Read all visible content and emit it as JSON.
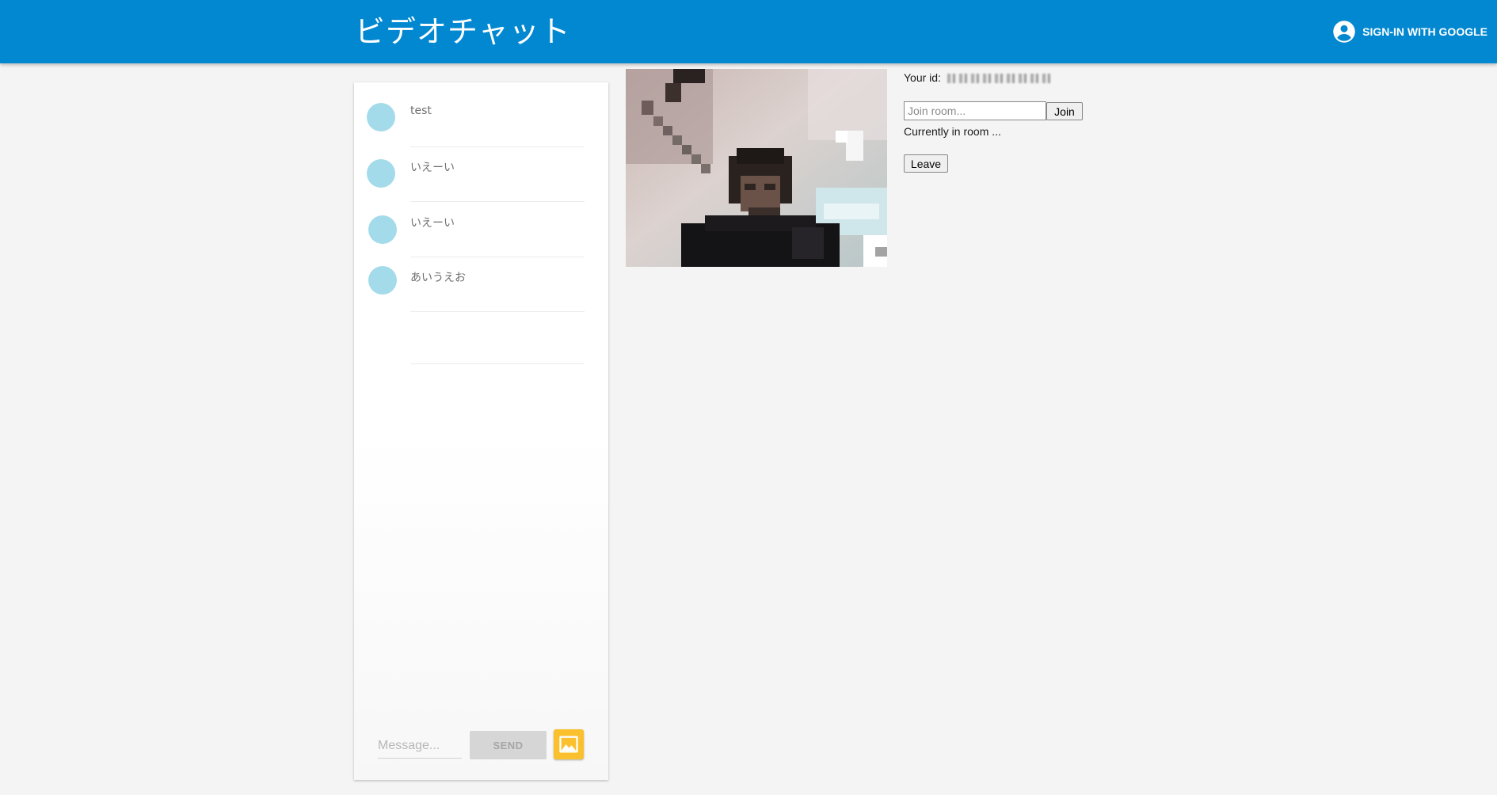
{
  "header": {
    "title": "ビデオチャット",
    "signin_label": "SIGN-IN WITH GOOGLE",
    "signin_icon": "account-circle-icon",
    "color": "#0288d1"
  },
  "chat": {
    "messages": [
      {
        "text": "test"
      },
      {
        "text": "いえーい"
      },
      {
        "text": "いえーい"
      },
      {
        "text": "あいうえお"
      }
    ],
    "avatar_color": "#a4dbea",
    "composer": {
      "placeholder": "Message...",
      "send_label": "SEND",
      "image_icon": "image-icon",
      "image_button_color": "#fbc02d"
    }
  },
  "controls": {
    "your_id_label": "Your id:",
    "join_placeholder": "Join room...",
    "join_label": "Join",
    "room_status": "Currently in room ...",
    "leave_label": "Leave"
  }
}
